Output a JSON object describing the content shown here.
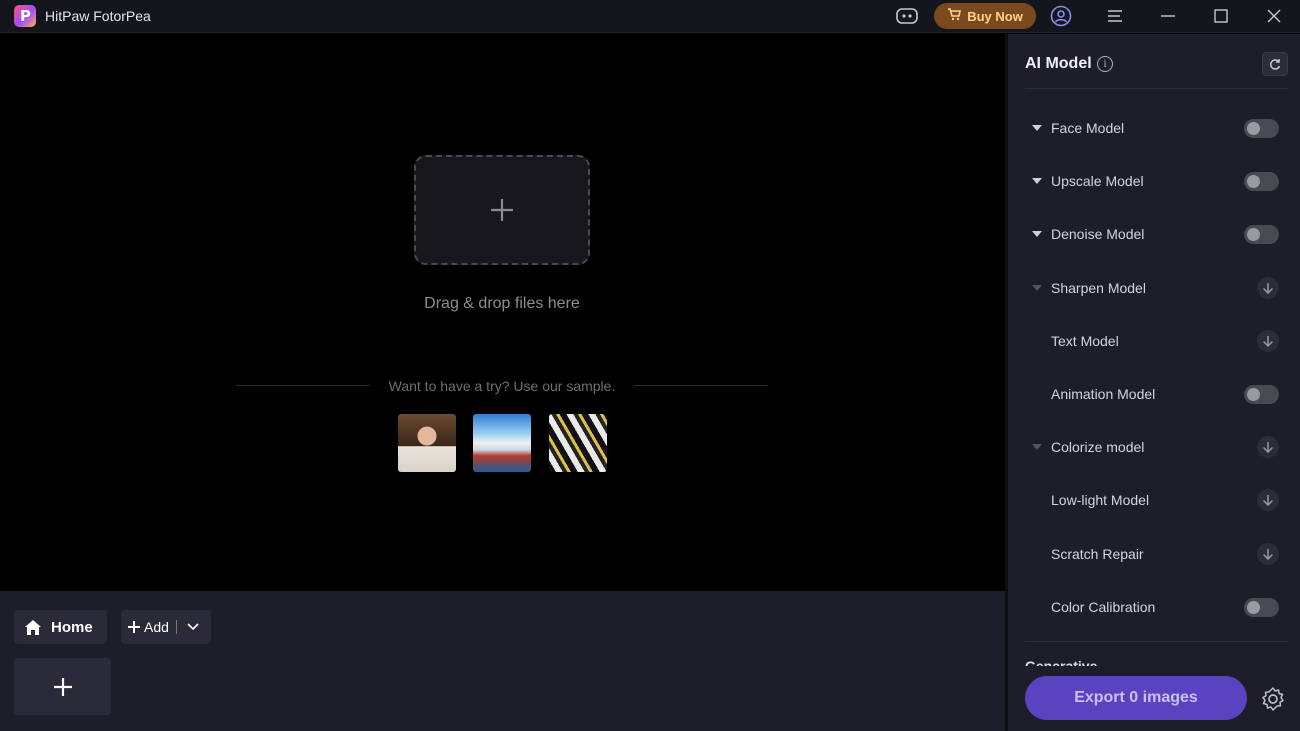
{
  "titlebar": {
    "app_name": "HitPaw FotorPea",
    "buy_label": "Buy Now"
  },
  "canvas": {
    "drop_text": "Drag & drop files here",
    "sample_text": "Want to have a try? Use our sample."
  },
  "bottom": {
    "home_label": "Home",
    "add_label": "Add"
  },
  "panel": {
    "title": "AI Model",
    "models": [
      {
        "label": "Face Model",
        "control": "toggle",
        "expandable": true
      },
      {
        "label": "Upscale Model",
        "control": "toggle",
        "expandable": true
      },
      {
        "label": "Denoise Model",
        "control": "toggle",
        "expandable": true
      },
      {
        "label": "Sharpen Model",
        "control": "download",
        "expandable": true
      },
      {
        "label": "Text Model",
        "control": "download",
        "expandable": false
      },
      {
        "label": "Animation Model",
        "control": "toggle",
        "expandable": false
      },
      {
        "label": "Colorize model",
        "control": "download",
        "expandable": true
      },
      {
        "label": "Low-light Model",
        "control": "download",
        "expandable": false
      },
      {
        "label": "Scratch Repair",
        "control": "download",
        "expandable": false
      },
      {
        "label": "Color Calibration",
        "control": "toggle",
        "expandable": false
      }
    ],
    "section_next": "Generative",
    "export_label": "Export 0 images"
  },
  "colors": {
    "accent": "#5a43c0",
    "buy_bg": "#7a4a1e",
    "buy_text": "#ffd38a"
  }
}
